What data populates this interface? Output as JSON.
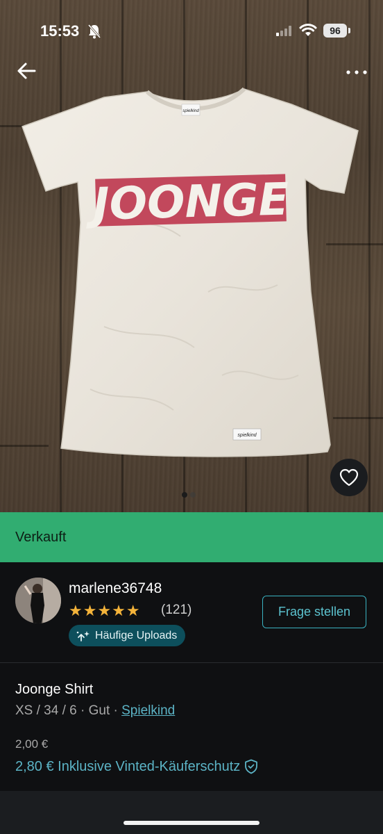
{
  "status_bar": {
    "time": "15:53",
    "battery": "96",
    "icons": [
      "bell-off-icon",
      "signal-icon",
      "wifi-icon",
      "battery-icon"
    ]
  },
  "photo": {
    "shirt_print": "JOONGE",
    "collar_tag": "spielkind",
    "hem_tag": "spielkind",
    "colors": {
      "print": "#c2485c",
      "shirt": "#efebe3",
      "floor": "#514232"
    }
  },
  "nav": {
    "back_icon": "arrow-left-icon",
    "more_icon": "more-horizontal-icon"
  },
  "favorite": {
    "icon": "heart-icon"
  },
  "sold_banner": {
    "label": "Verkauft",
    "color": "#31ad71"
  },
  "seller": {
    "username": "marlene36748",
    "stars": "★★★★★",
    "reviews": "(121)",
    "badge_label": "Häufige Uploads",
    "ask_button": "Frage stellen"
  },
  "item": {
    "title": "Joonge Shirt",
    "meta_prefix": "XS / 34 / 6 · Gut · ",
    "brand": "Spielkind",
    "price": "2,00 €",
    "price_with_protection": "2,80 € Inklusive Vinted-Käuferschutz"
  }
}
